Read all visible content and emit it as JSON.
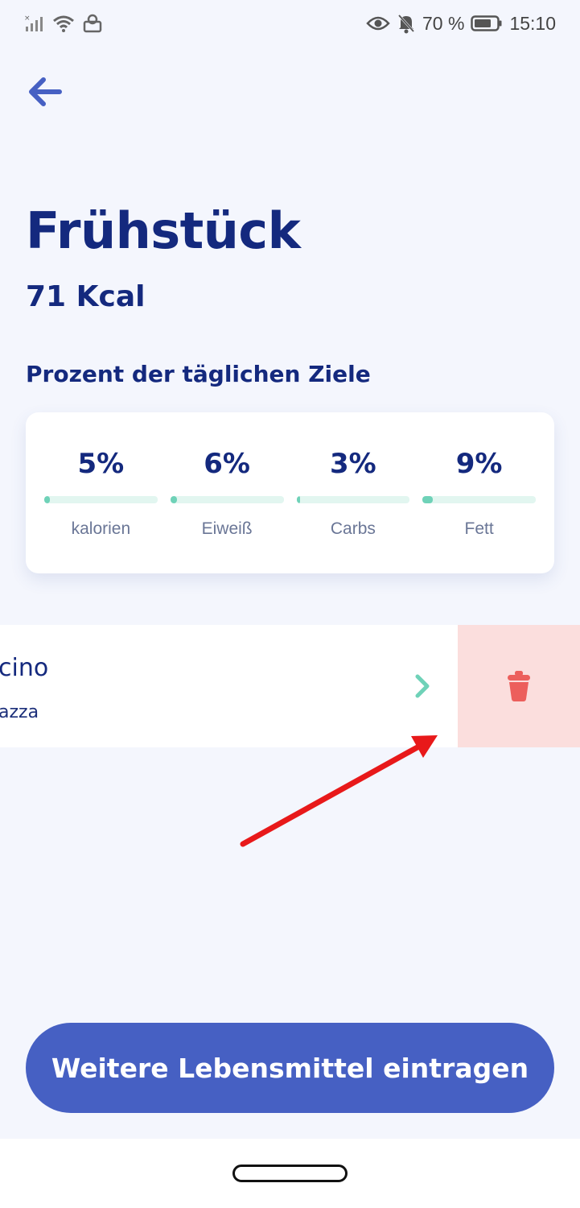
{
  "status_bar": {
    "battery_percent": "70 %",
    "time": "15:10",
    "icons": [
      "signal-icon",
      "wifi-icon",
      "cast-icon",
      "eye-icon",
      "mute-icon",
      "battery-icon"
    ]
  },
  "header": {
    "title": "Frühstück",
    "kcal": "71 Kcal"
  },
  "goals": {
    "heading": "Prozent der täglichen Ziele",
    "items": [
      {
        "percent": "5%",
        "label": "kalorien",
        "fill": 0.05
      },
      {
        "percent": "6%",
        "label": "Eiweiß",
        "fill": 0.06
      },
      {
        "percent": "3%",
        "label": "Carbs",
        "fill": 0.03
      },
      {
        "percent": "9%",
        "label": "Fett",
        "fill": 0.09
      }
    ]
  },
  "food_item": {
    "name": "cino",
    "portion": "azza"
  },
  "actions": {
    "add_button_label": "Weitere Lebensmittel eintragen"
  },
  "colors": {
    "primary": "#4660c3",
    "title": "#14297e",
    "accent": "#6fd2b8",
    "delete_bg": "#fbdedd",
    "delete_icon": "#ec5f5c",
    "annotation": "#e8191a"
  }
}
